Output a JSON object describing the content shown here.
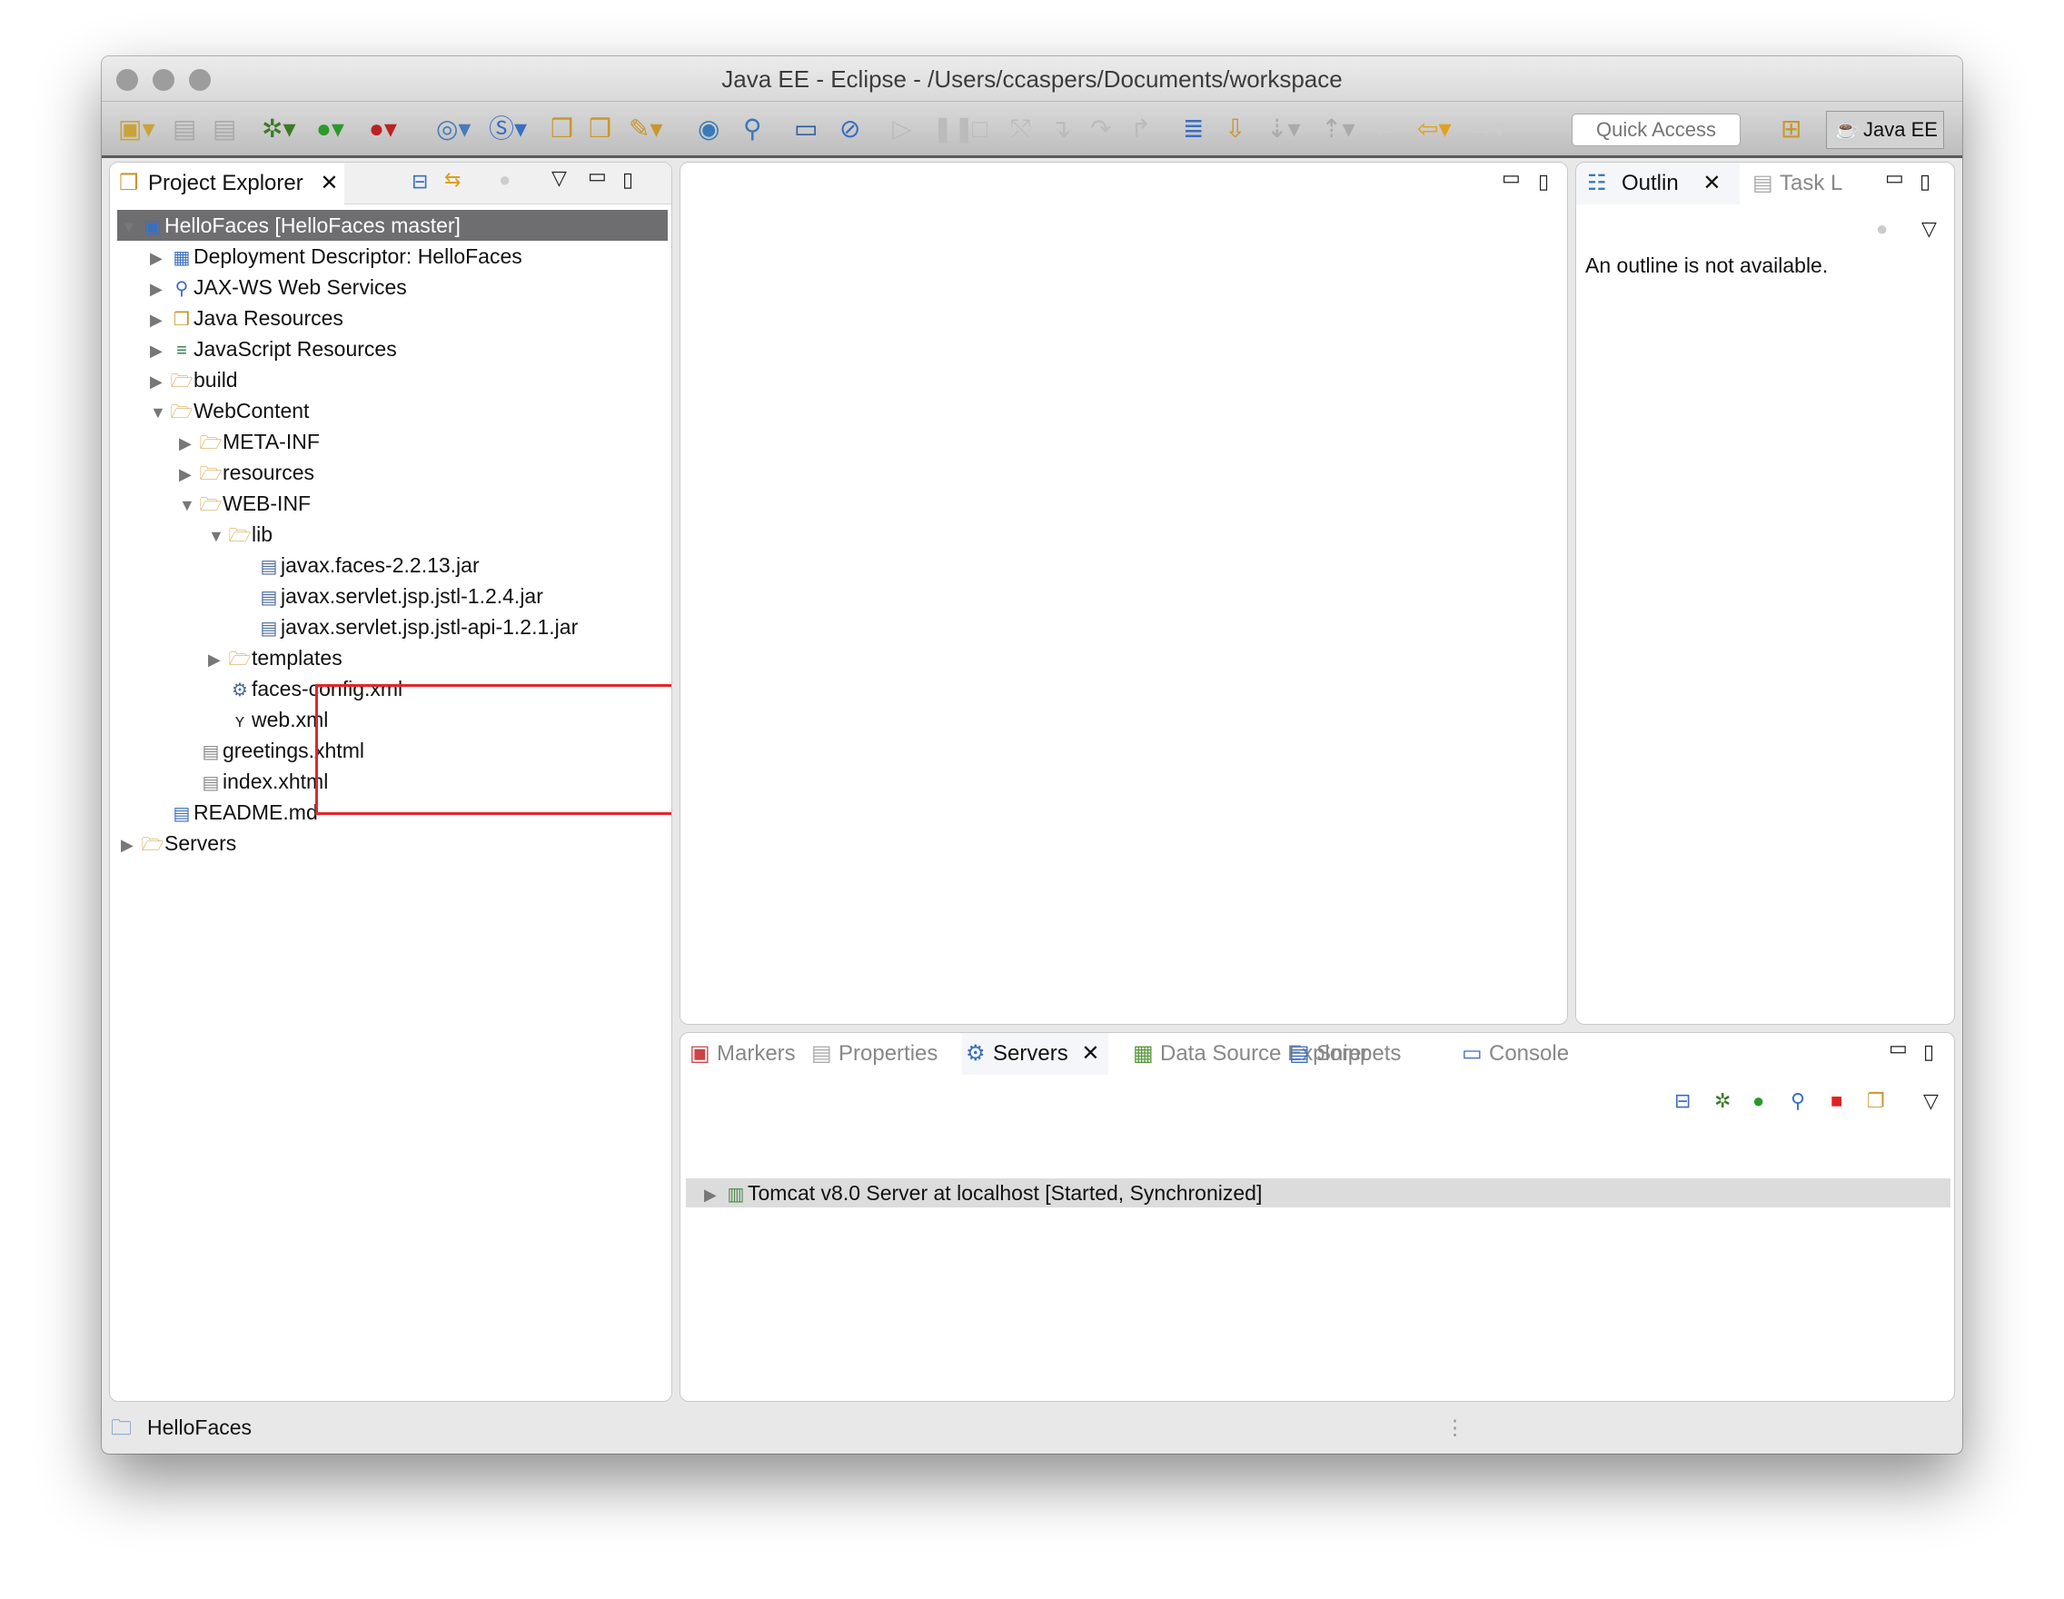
{
  "window": {
    "title": "Java EE - Eclipse - /Users/ccaspers/Documents/workspace"
  },
  "toolbar": {
    "quick_access_placeholder": "Quick Access",
    "perspective_label": "Java EE"
  },
  "project_explorer": {
    "tab_label": "Project Explorer",
    "tree": [
      {
        "label": "HelloFaces  [HelloFaces master]",
        "depth": 0,
        "state": "expanded",
        "icon": "project-icon",
        "selected": true
      },
      {
        "label": "Deployment Descriptor: HelloFaces",
        "depth": 1,
        "state": "collapsed",
        "icon": "deployment-descriptor-icon"
      },
      {
        "label": "JAX-WS Web Services",
        "depth": 1,
        "state": "collapsed",
        "icon": "web-services-icon"
      },
      {
        "label": "Java Resources",
        "depth": 1,
        "state": "collapsed",
        "icon": "java-resources-icon"
      },
      {
        "label": "JavaScript Resources",
        "depth": 1,
        "state": "collapsed",
        "icon": "javascript-resources-icon"
      },
      {
        "label": "build",
        "depth": 1,
        "state": "collapsed",
        "icon": "folder-icon"
      },
      {
        "label": "WebContent",
        "depth": 1,
        "state": "expanded",
        "icon": "folder-icon"
      },
      {
        "label": "META-INF",
        "depth": 2,
        "state": "collapsed",
        "icon": "folder-icon"
      },
      {
        "label": "resources",
        "depth": 2,
        "state": "collapsed",
        "icon": "folder-icon"
      },
      {
        "label": "WEB-INF",
        "depth": 2,
        "state": "expanded",
        "icon": "folder-icon"
      },
      {
        "label": "lib",
        "depth": 3,
        "state": "expanded",
        "icon": "folder-icon"
      },
      {
        "label": "javax.faces-2.2.13.jar",
        "depth": 4,
        "state": "leaf",
        "icon": "jar-icon"
      },
      {
        "label": "javax.servlet.jsp.jstl-1.2.4.jar",
        "depth": 4,
        "state": "leaf",
        "icon": "jar-icon"
      },
      {
        "label": "javax.servlet.jsp.jstl-api-1.2.1.jar",
        "depth": 4,
        "state": "leaf",
        "icon": "jar-icon"
      },
      {
        "label": "templates",
        "depth": 3,
        "state": "collapsed",
        "icon": "folder-icon"
      },
      {
        "label": "faces-config.xml",
        "depth": 3,
        "state": "leaf",
        "icon": "faces-config-icon"
      },
      {
        "label": "web.xml",
        "depth": 3,
        "state": "leaf",
        "icon": "xml-file-icon"
      },
      {
        "label": "greetings.xhtml",
        "depth": 2,
        "state": "leaf",
        "icon": "file-icon"
      },
      {
        "label": "index.xhtml",
        "depth": 2,
        "state": "leaf",
        "icon": "file-icon"
      },
      {
        "label": "README.md",
        "depth": 1,
        "state": "leaf",
        "icon": "markdown-file-icon"
      },
      {
        "label": "Servers",
        "depth": 0,
        "state": "collapsed",
        "icon": "folder-icon"
      }
    ]
  },
  "outline": {
    "tabs": [
      "Outlin",
      "Task L"
    ],
    "message": "An outline is not available."
  },
  "bottom_panel": {
    "tabs": [
      "Markers",
      "Properties",
      "Servers",
      "Data Source Explorer",
      "Snippets",
      "Console"
    ],
    "active_tab": "Servers",
    "servers": [
      {
        "label": "Tomcat v8.0 Server at localhost  [Started, Synchronized]"
      }
    ]
  },
  "status_bar": {
    "text": "HelloFaces"
  },
  "colors": {
    "selection": "#6e6e70",
    "highlight_box": "#e4262a"
  }
}
